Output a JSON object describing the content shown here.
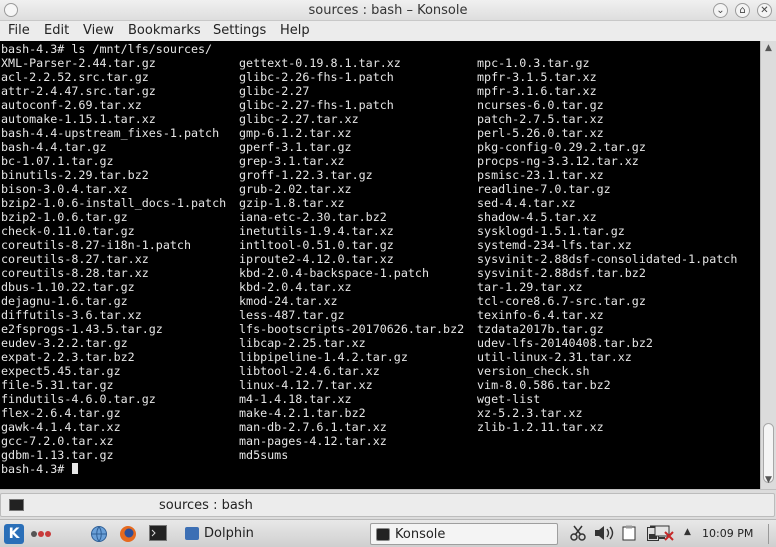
{
  "window": {
    "title": "sources : bash – Konsole",
    "minimize_glyph": "⌄",
    "maximize_glyph": "⌂",
    "close_glyph": "✕"
  },
  "menu": [
    "File",
    "Edit",
    "View",
    "Bookmarks",
    "Settings",
    "Help"
  ],
  "terminal": {
    "command_line": "bash-4.3# ls /mnt/lfs/sources/",
    "prompt": "bash-4.3# ",
    "columns": [
      [
        "XML-Parser-2.44.tar.gz",
        "acl-2.2.52.src.tar.gz",
        "attr-2.4.47.src.tar.gz",
        "autoconf-2.69.tar.xz",
        "automake-1.15.1.tar.xz",
        "bash-4.4-upstream_fixes-1.patch",
        "bash-4.4.tar.gz",
        "bc-1.07.1.tar.gz",
        "binutils-2.29.tar.bz2",
        "bison-3.0.4.tar.xz",
        "bzip2-1.0.6-install_docs-1.patch",
        "bzip2-1.0.6.tar.gz",
        "check-0.11.0.tar.gz",
        "coreutils-8.27-i18n-1.patch",
        "coreutils-8.27.tar.xz",
        "coreutils-8.28.tar.xz",
        "dbus-1.10.22.tar.gz",
        "dejagnu-1.6.tar.gz",
        "diffutils-3.6.tar.xz",
        "e2fsprogs-1.43.5.tar.gz",
        "eudev-3.2.2.tar.gz",
        "expat-2.2.3.tar.bz2",
        "expect5.45.tar.gz",
        "file-5.31.tar.gz",
        "findutils-4.6.0.tar.gz",
        "flex-2.6.4.tar.gz",
        "gawk-4.1.4.tar.xz",
        "gcc-7.2.0.tar.xz",
        "gdbm-1.13.tar.gz"
      ],
      [
        "gettext-0.19.8.1.tar.xz",
        "glibc-2.26-fhs-1.patch",
        "glibc-2.27",
        "glibc-2.27-fhs-1.patch",
        "glibc-2.27.tar.xz",
        "gmp-6.1.2.tar.xz",
        "gperf-3.1.tar.gz",
        "grep-3.1.tar.xz",
        "groff-1.22.3.tar.gz",
        "grub-2.02.tar.xz",
        "gzip-1.8.tar.xz",
        "iana-etc-2.30.tar.bz2",
        "inetutils-1.9.4.tar.xz",
        "intltool-0.51.0.tar.gz",
        "iproute2-4.12.0.tar.xz",
        "kbd-2.0.4-backspace-1.patch",
        "kbd-2.0.4.tar.xz",
        "kmod-24.tar.xz",
        "less-487.tar.gz",
        "lfs-bootscripts-20170626.tar.bz2",
        "libcap-2.25.tar.xz",
        "libpipeline-1.4.2.tar.gz",
        "libtool-2.4.6.tar.xz",
        "linux-4.12.7.tar.xz",
        "m4-1.4.18.tar.xz",
        "make-4.2.1.tar.bz2",
        "man-db-2.7.6.1.tar.xz",
        "man-pages-4.12.tar.xz",
        "md5sums"
      ],
      [
        "mpc-1.0.3.tar.gz",
        "mpfr-3.1.5.tar.xz",
        "mpfr-3.1.6.tar.xz",
        "ncurses-6.0.tar.gz",
        "patch-2.7.5.tar.xz",
        "perl-5.26.0.tar.xz",
        "pkg-config-0.29.2.tar.gz",
        "procps-ng-3.3.12.tar.xz",
        "psmisc-23.1.tar.xz",
        "readline-7.0.tar.gz",
        "sed-4.4.tar.xz",
        "shadow-4.5.tar.xz",
        "sysklogd-1.5.1.tar.gz",
        "systemd-234-lfs.tar.xz",
        "sysvinit-2.88dsf-consolidated-1.patch",
        "sysvinit-2.88dsf.tar.bz2",
        "tar-1.29.tar.xz",
        "tcl-core8.6.7-src.tar.gz",
        "texinfo-6.4.tar.xz",
        "tzdata2017b.tar.gz",
        "udev-lfs-20140408.tar.bz2",
        "util-linux-2.31.tar.xz",
        "version_check.sh",
        "vim-8.0.586.tar.bz2",
        "wget-list",
        "xz-5.2.3.tar.xz",
        "zlib-1.2.11.tar.xz"
      ]
    ]
  },
  "tab": {
    "label": "sources : bash"
  },
  "taskbar": {
    "kicker_label": "K",
    "dolphin_label": "Dolphin",
    "konsole_label": "Konsole",
    "clock": "10:09 PM",
    "tray_up_glyph": "▲"
  }
}
